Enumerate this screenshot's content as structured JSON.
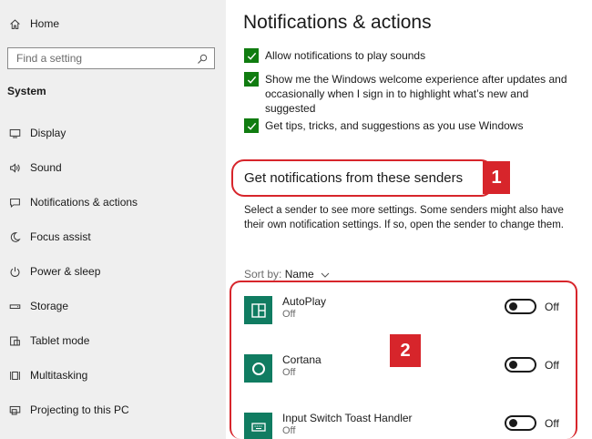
{
  "sidebar": {
    "home_label": "Home",
    "search_placeholder": "Find a setting",
    "section_title": "System",
    "items": [
      {
        "label": "Display"
      },
      {
        "label": "Sound"
      },
      {
        "label": "Notifications & actions"
      },
      {
        "label": "Focus assist"
      },
      {
        "label": "Power & sleep"
      },
      {
        "label": "Storage"
      },
      {
        "label": "Tablet mode"
      },
      {
        "label": "Multitasking"
      },
      {
        "label": "Projecting to this PC"
      }
    ]
  },
  "main": {
    "title": "Notifications & actions",
    "checkboxes": [
      {
        "label": "Allow notifications to play sounds",
        "checked": true
      },
      {
        "label": "Show me the Windows welcome experience after updates and occasionally when I sign in to highlight what’s new and suggested",
        "checked": true
      },
      {
        "label": "Get tips, tricks, and suggestions as you use Windows",
        "checked": true
      }
    ],
    "senders_heading": "Get notifications from these senders",
    "senders_description": "Select a sender to see more settings. Some senders might also have their own notification settings. If so, open the sender to change them.",
    "sort_label": "Sort by:",
    "sort_value": "Name",
    "senders": [
      {
        "name": "AutoPlay",
        "status": "Off",
        "toggle_label": "Off",
        "icon": "autoplay-icon"
      },
      {
        "name": "Cortana",
        "status": "Off",
        "toggle_label": "Off",
        "icon": "cortana-icon"
      },
      {
        "name": "Input Switch Toast Handler",
        "status": "Off",
        "toggle_label": "Off",
        "icon": "keyboard-icon"
      }
    ]
  },
  "annotations": {
    "badge_1": "1",
    "badge_2": "2"
  },
  "colors": {
    "accent_green": "#107c10",
    "tile_teal": "#107c61",
    "annotation_red": "#d7252b",
    "sidebar_bg": "#efefef"
  }
}
